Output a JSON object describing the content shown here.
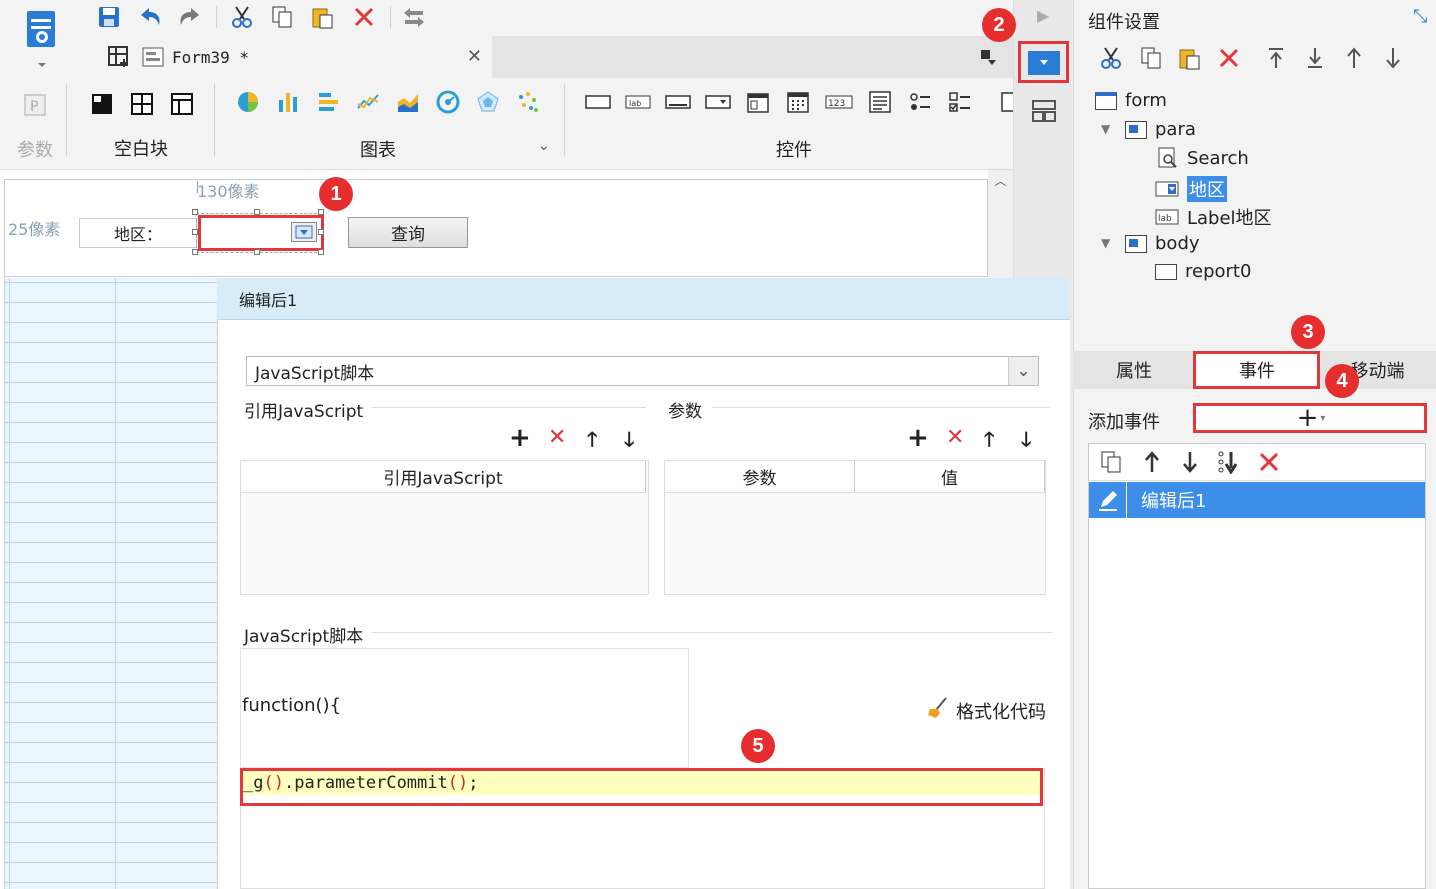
{
  "toolbar": {
    "doc_tab": "Form39 *",
    "params_label": "参数",
    "blank_label": "空白块",
    "chart_label": "图表",
    "control_label": "控件"
  },
  "canvas": {
    "width_hint": "130像素",
    "height_hint": "25像素",
    "region_label": "地区：",
    "query_button": "查询"
  },
  "editor": {
    "title": "编辑后1",
    "type_select": "JavaScript脚本",
    "ref_js_group": "引用JavaScript",
    "params_group": "参数",
    "ref_js_col": "引用JavaScript",
    "param_col": "参数",
    "value_col": "值",
    "script_group": "JavaScript脚本",
    "function_header": "function(){",
    "format_code": "格式化代码",
    "code_prefix": "_g",
    "code_open": "(",
    "code_close": ")",
    "code_middle": ".parameterCommit",
    "code_open2": "(",
    "code_close2": ")",
    "code_end": ";"
  },
  "right_panel": {
    "title": "组件设置",
    "tree": {
      "form": "form",
      "para": "para",
      "search": "Search",
      "region": "地区",
      "label_region": "Label地区",
      "body": "body",
      "report0": "report0"
    },
    "tabs": [
      "属性",
      "事件",
      "移动端"
    ],
    "add_event_label": "添加事件",
    "event_item": "编辑后1"
  },
  "markers": [
    "1",
    "2",
    "3",
    "4",
    "5"
  ],
  "colors": {
    "accent": "#2a7dd6",
    "highlight_red": "#e2383d",
    "selected_blue": "#3d8ee8",
    "code_bg": "#ffffc0"
  }
}
